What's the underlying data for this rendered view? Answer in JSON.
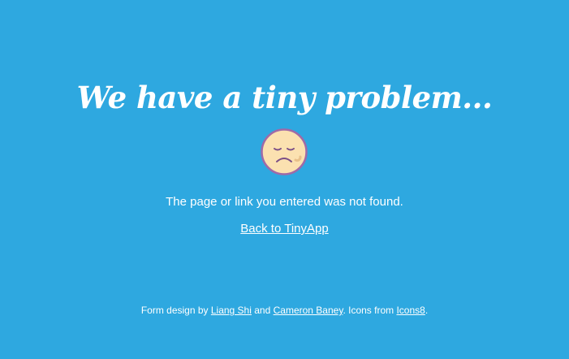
{
  "colors": {
    "background": "#2ea8e0",
    "text": "#ffffff",
    "face_fill": "#fbe1b0",
    "face_outline": "#a06aa7"
  },
  "headline": "We have a tiny problem...",
  "face_icon": "sad-face-icon",
  "message": "The page or link you entered was not found.",
  "back_link": "Back to TinyApp",
  "footer": {
    "prefix": "Form design by ",
    "author1": "Liang Shi",
    "and": " and ",
    "author2": "Cameron Baney",
    "icons_text": ". Icons from ",
    "icons_source": "Icons8",
    "suffix": "."
  }
}
